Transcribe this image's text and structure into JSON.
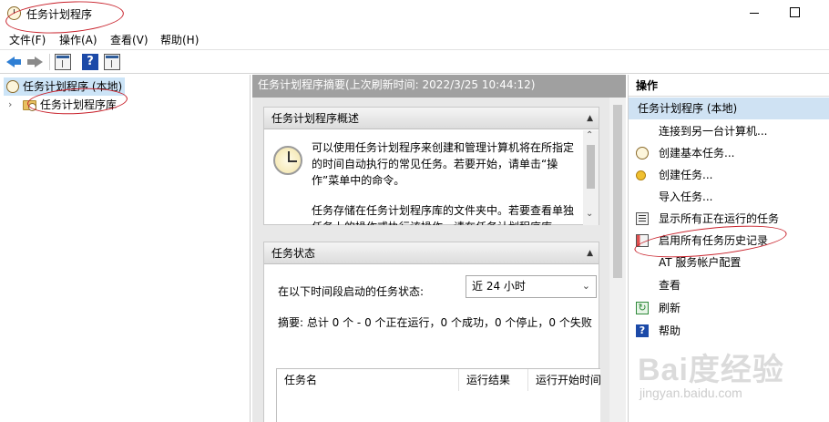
{
  "window": {
    "title": "任务计划程序",
    "minimize_icon": "minimize-icon",
    "maximize_icon": "maximize-icon"
  },
  "menu": [
    "文件(F)",
    "操作(A)",
    "查看(V)",
    "帮助(H)"
  ],
  "toolbar": {
    "icons": [
      "back-arrow-icon",
      "forward-arrow-icon",
      "show-hide-console-tree-icon",
      "help-icon",
      "show-hide-action-pane-icon"
    ]
  },
  "tree": {
    "root": "任务计划程序 (本地)",
    "child": "任务计划程序库",
    "expander": "›"
  },
  "center": {
    "header": "任务计划程序摘要(上次刷新时间: 2022/3/25 10:44:12)",
    "overview": {
      "title": "任务计划程序概述",
      "paragraph1": "可以使用任务计划程序来创建和管理计算机将在所指定的时间自动执行的常见任务。若要开始，请单击“操作”菜单中的命令。",
      "paragraph2": "任务存储在任务计划程序库的文件夹中。若要查看单独任务上的操作或执行该操作，请在任务计划程序库"
    },
    "status": {
      "title": "任务状态",
      "period_label": "在以下时间段启动的任务状态:",
      "period_value": "近 24 小时",
      "summary": "摘要: 总计 0 个 - 0 个正在运行，0 个成功，0 个停止，0 个失败",
      "columns": [
        "任务名",
        "运行结果",
        "运行开始时间"
      ]
    },
    "collapse_glyph": "▲",
    "dropdown_glyph": "⌄",
    "scroll_up": "⌃",
    "scroll_down": "⌄"
  },
  "actions": {
    "title": "操作",
    "section": "任务计划程序 (本地)",
    "items": [
      {
        "label": "连接到另一台计算机...",
        "icon": ""
      },
      {
        "label": "创建基本任务...",
        "icon": "create-basic-task-icon"
      },
      {
        "label": "创建任务...",
        "icon": "create-task-icon"
      },
      {
        "label": "导入任务...",
        "icon": ""
      },
      {
        "label": "显示所有正在运行的任务",
        "icon": "running-tasks-icon"
      },
      {
        "label": "启用所有任务历史记录",
        "icon": "task-history-icon"
      },
      {
        "label": "AT 服务帐户配置",
        "icon": ""
      },
      {
        "label": "查看",
        "icon": ""
      },
      {
        "label": "刷新",
        "icon": "refresh-icon"
      },
      {
        "label": "帮助",
        "icon": "help-icon"
      }
    ]
  },
  "watermark": {
    "logo": "Bai度经验",
    "url": "jingyan.baidu.com"
  },
  "annotation_color": "#c8202a"
}
